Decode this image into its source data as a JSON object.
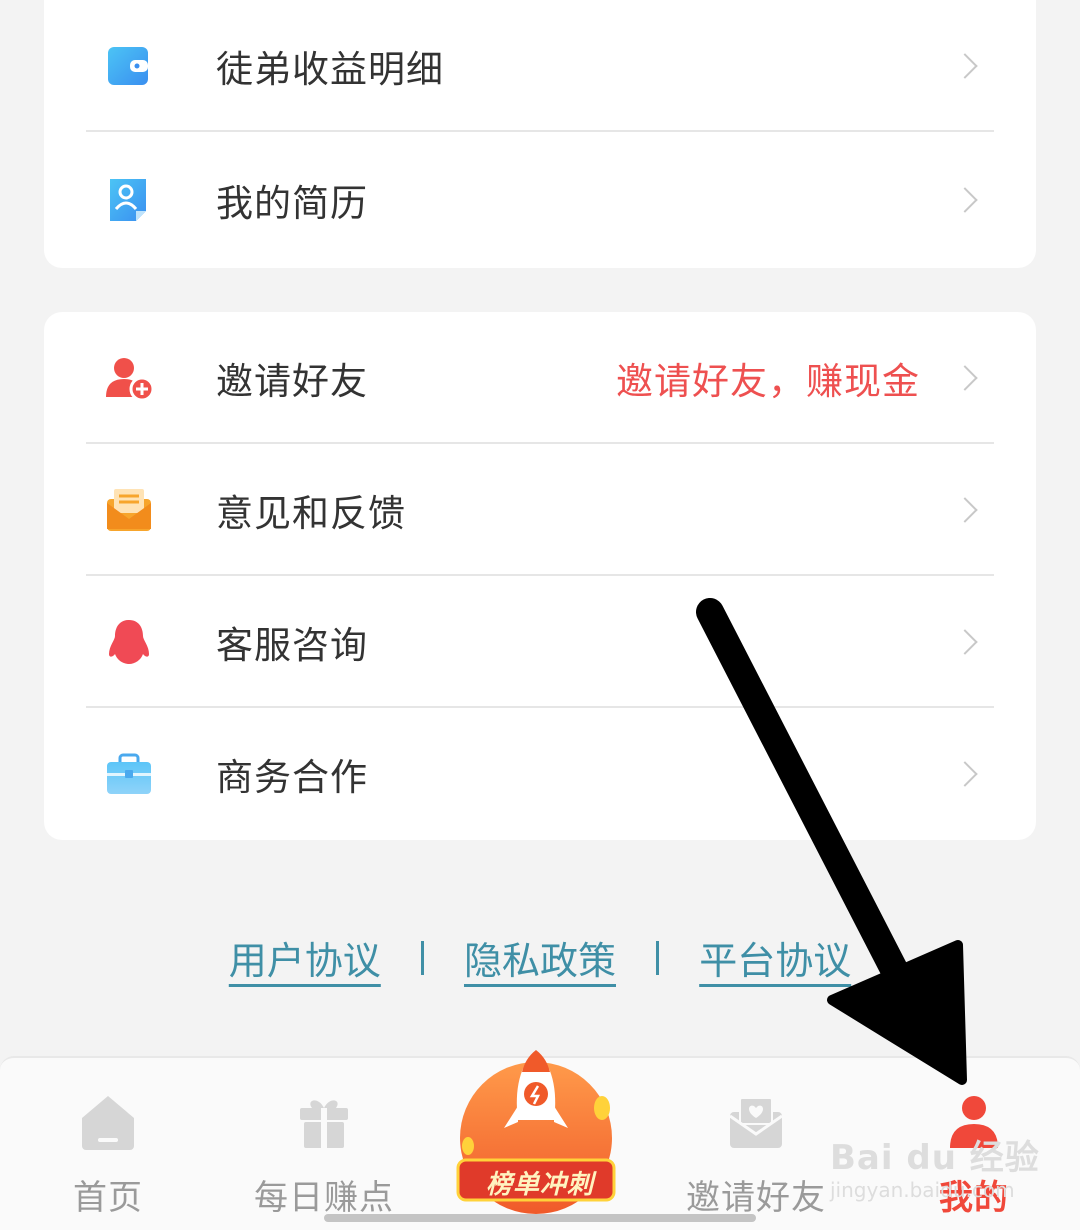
{
  "section_one": {
    "items": [
      {
        "label": "徒弟收益明细",
        "icon": "wallet-icon"
      },
      {
        "label": "我的简历",
        "icon": "resume-icon"
      }
    ]
  },
  "section_two": {
    "items": [
      {
        "label": "邀请好友",
        "hint": "邀请好友，赚现金",
        "icon": "invite-user-icon"
      },
      {
        "label": "意见和反馈",
        "icon": "feedback-mail-icon"
      },
      {
        "label": "客服咨询",
        "icon": "qq-penguin-icon"
      },
      {
        "label": "商务合作",
        "icon": "briefcase-icon"
      }
    ]
  },
  "footer_links": {
    "user_agreement": "用户协议",
    "privacy_policy": "隐私政策",
    "platform_agreement": "平台协议"
  },
  "tabbar": {
    "home": "首页",
    "daily_earn": "每日赚点",
    "center_badge": "榜单冲刺",
    "invite": "邀请好友",
    "mine": "我的"
  },
  "colors": {
    "accent_red": "#f0483a",
    "hint_red": "#ee5050",
    "link_teal": "#3f8fa6",
    "inactive_gray": "#9a9a9a"
  },
  "watermark": {
    "brand": "Bai du 经验",
    "url": "jingyan.baidu.com"
  }
}
